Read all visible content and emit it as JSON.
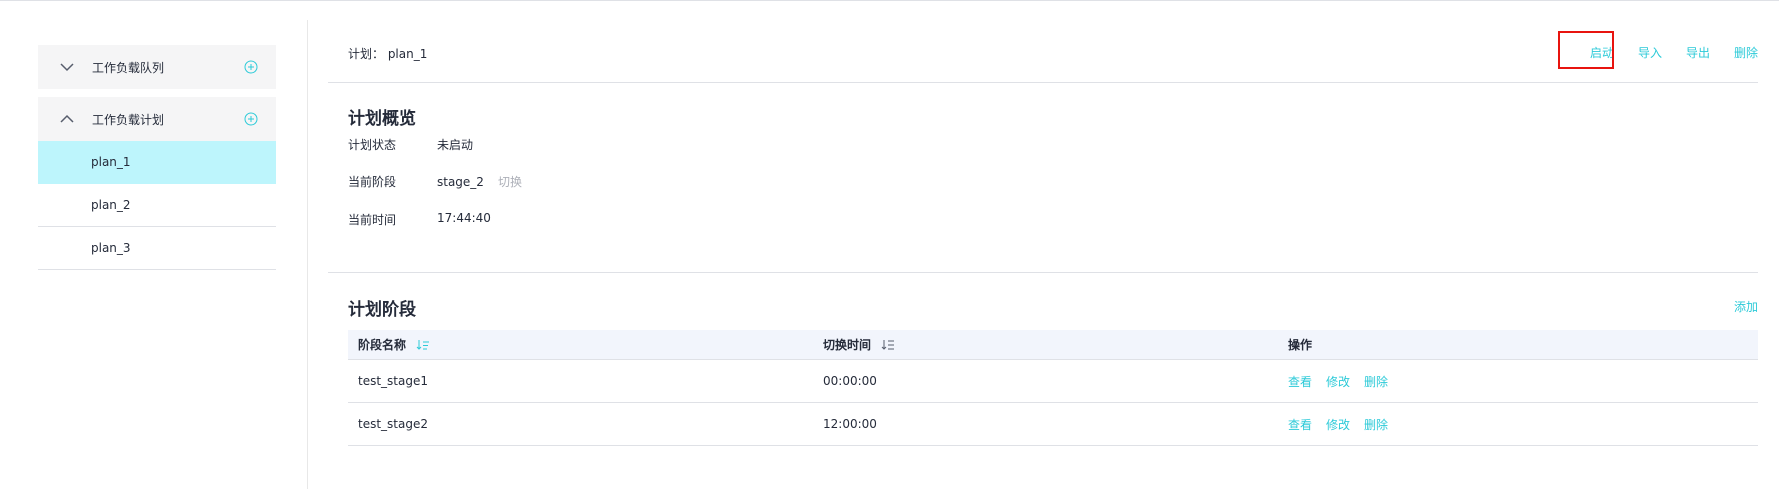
{
  "sidebar": {
    "groups": [
      {
        "label": "工作负载队列",
        "expanded": false
      },
      {
        "label": "工作负载计划",
        "expanded": true
      }
    ],
    "plans": [
      "plan_1",
      "plan_2",
      "plan_3"
    ],
    "active_plan": "plan_1"
  },
  "header": {
    "plan_label": "计划：  plan_1",
    "actions": [
      "启动",
      "导入",
      "导出",
      "删除"
    ]
  },
  "overview": {
    "title": "计划概览",
    "fields": [
      {
        "label": "计划状态",
        "value": "未启动"
      },
      {
        "label": "当前阶段",
        "value": "stage_2",
        "link": "切换"
      },
      {
        "label": "当前时间",
        "value": "17:44:40"
      }
    ]
  },
  "stages": {
    "title": "计划阶段",
    "add_label": "添加",
    "columns": [
      "阶段名称",
      "切换时间",
      "操作"
    ],
    "rows": [
      {
        "name": "test_stage1",
        "time": "00:00:00",
        "ops": [
          "查看",
          "修改",
          "删除"
        ]
      },
      {
        "name": "test_stage2",
        "time": "12:00:00",
        "ops": [
          "查看",
          "修改",
          "删除"
        ]
      }
    ]
  },
  "colors": {
    "accent": "#2ccad8",
    "active_bg": "#bdf5fc",
    "highlight": "#e8140f"
  }
}
